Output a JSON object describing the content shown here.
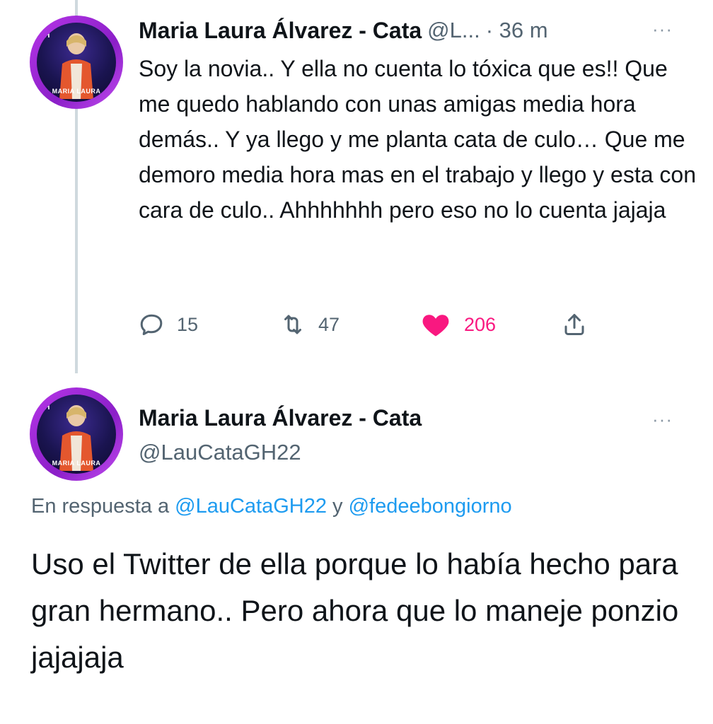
{
  "tweet1": {
    "avatar": {
      "badge": "GH",
      "caption": "MARIA LAURA"
    },
    "display_name": "Maria Laura Álvarez - Cata",
    "handle_truncated": "@L...",
    "time": "· 36 m",
    "more": "···",
    "text": "Soy la novia.. Y ella no cuenta lo tóxica que es!! Que me quedo hablando con unas amigas media hora demás.. Y ya llego y me planta cata de culo… Que me demoro media hora mas en el trabajo y llego y esta con cara de culo.. Ahhhhhhh pero eso no lo cuenta jajaja",
    "actions": {
      "replies": "15",
      "retweets": "47",
      "likes": "206"
    }
  },
  "tweet2": {
    "avatar": {
      "badge": "GH",
      "caption": "MARIA LAURA"
    },
    "display_name": "Maria Laura Álvarez - Cata",
    "handle": "@LauCataGH22",
    "more": "···",
    "reply_prefix": "En respuesta a",
    "reply_mention_1": "@LauCataGH22",
    "reply_joiner": "y",
    "reply_mention_2": "@fedeebongiorno",
    "text": "Uso el Twitter de ella porque lo había hecho para gran hermano.. Pero ahora que lo maneje ponzio jajajaja"
  },
  "colors": {
    "accent_blue": "#1d9bf0",
    "like_pink": "#f91880",
    "muted_gray": "#536471",
    "avatar_ring": "#b636e8"
  }
}
